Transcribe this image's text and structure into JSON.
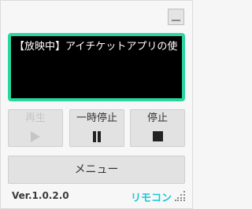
{
  "now_playing": "【放映中】アイチケットアプリの使い方",
  "controls": {
    "play_label": "再生",
    "pause_label": "一時停止",
    "stop_label": "停止",
    "play_enabled": false
  },
  "menu_label": "メニュー",
  "footer": {
    "version": "Ver.1.0.2.0",
    "app_name": "リモコン"
  },
  "colors": {
    "screen_border": "#2ad6a0",
    "app_name": "#18c9d6"
  },
  "icons": [
    "minimize-icon",
    "play-icon",
    "pause-icon",
    "stop-icon",
    "resize-grip-icon"
  ]
}
